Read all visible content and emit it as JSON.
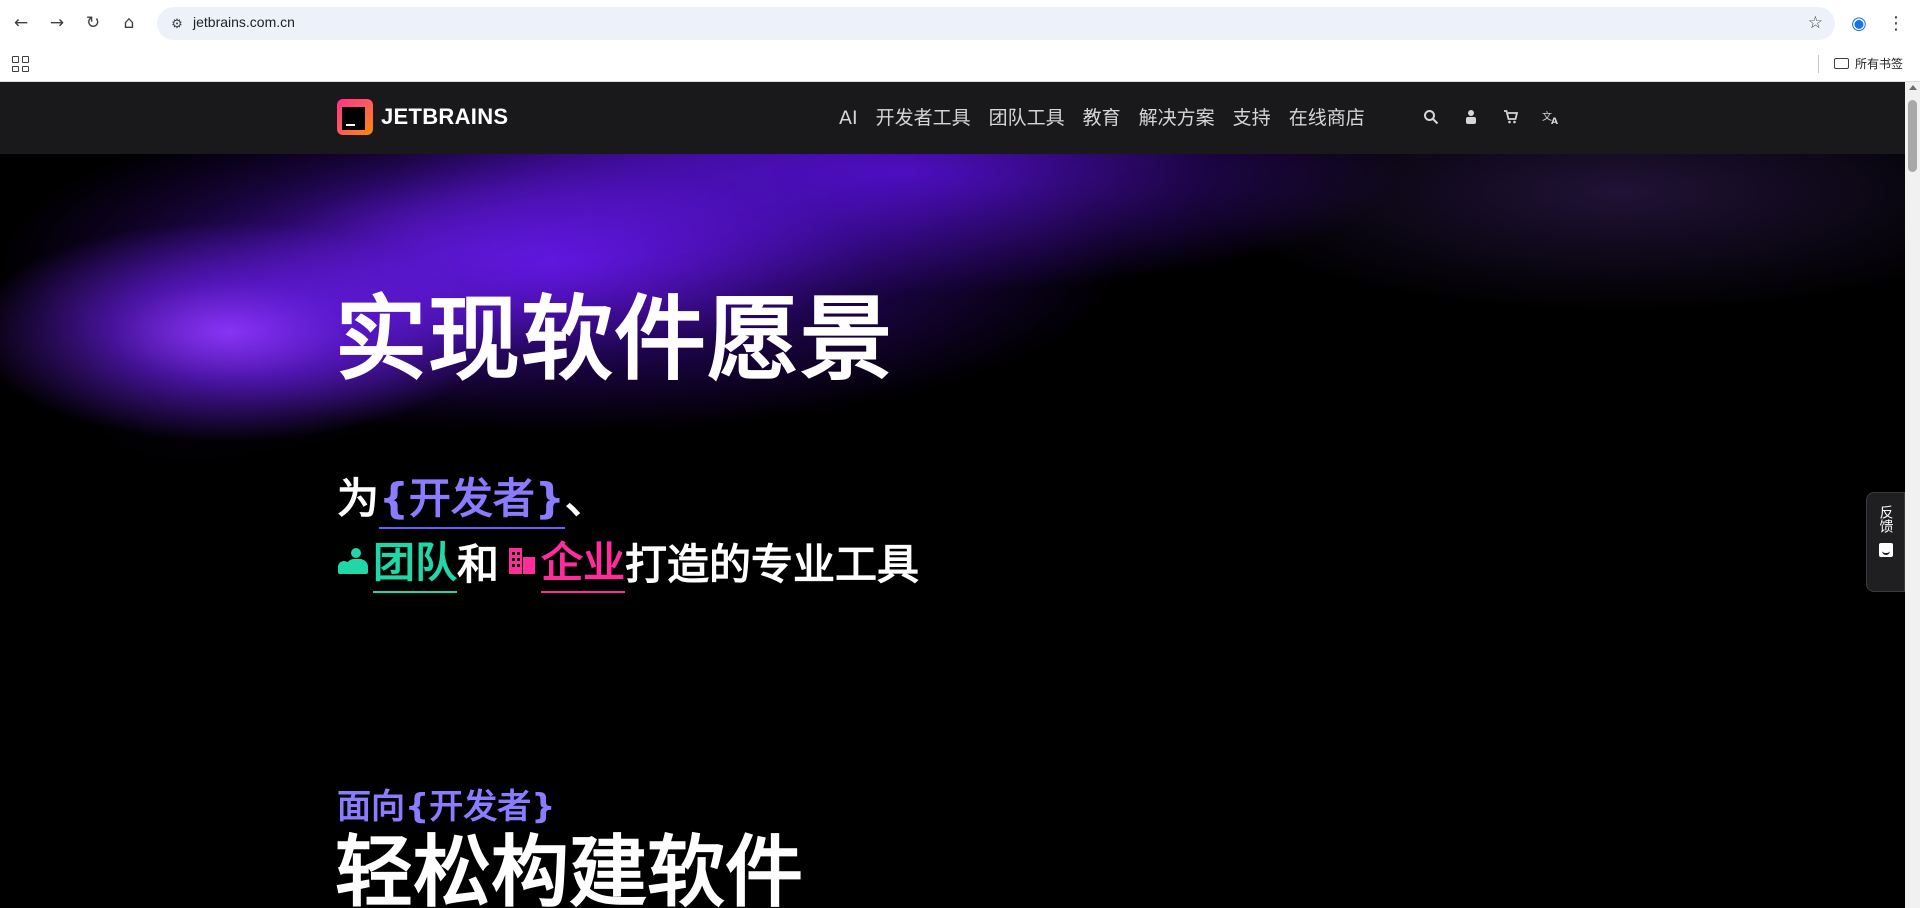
{
  "browser": {
    "url": "jetbrains.com.cn",
    "bookmarks_label": "所有书签"
  },
  "header": {
    "logo_text": "JETBRAINS",
    "nav": [
      "AI",
      "开发者工具",
      "团队工具",
      "教育",
      "解决方案",
      "支持",
      "在线商店"
    ]
  },
  "hero": {
    "title": "实现软件愿景",
    "line1_prefix": "为",
    "line1_dev": "{开发者}",
    "line1_suffix": "、",
    "line2_team": "团队",
    "line2_and": "和",
    "line2_ent": "企业",
    "line2_suffix": "打造的专业工具"
  },
  "section": {
    "kicker": "面向{开发者}",
    "title": "轻松构建软件"
  },
  "feedback": {
    "label": "反馈"
  },
  "colors": {
    "accent_dev": "#8b7bff",
    "accent_team": "#21d7a8",
    "accent_enterprise": "#ff2d9b",
    "header_bg": "#19191c"
  }
}
